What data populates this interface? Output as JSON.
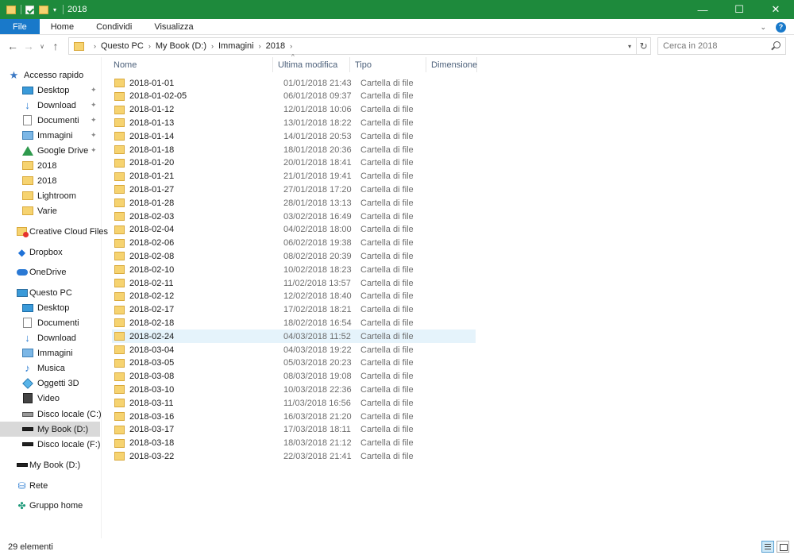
{
  "window": {
    "title": "2018",
    "controls": {
      "minimize": "—",
      "maximize": "☐",
      "close": "✕"
    }
  },
  "ribbon": {
    "tabs": [
      "File",
      "Home",
      "Condividi",
      "Visualizza"
    ]
  },
  "address": {
    "breadcrumbs": [
      "Questo PC",
      "My Book (D:)",
      "Immagini",
      "2018"
    ],
    "search_placeholder": "Cerca in 2018"
  },
  "sidebar": {
    "items": [
      {
        "label": "Accesso rapido",
        "icon": "star-icon",
        "level": 0,
        "pinned": false
      },
      {
        "label": "Desktop",
        "icon": "desktop-icon",
        "level": 1,
        "pinned": true
      },
      {
        "label": "Download",
        "icon": "download-icon",
        "level": 1,
        "pinned": true
      },
      {
        "label": "Documenti",
        "icon": "documents-icon",
        "level": 1,
        "pinned": true
      },
      {
        "label": "Immagini",
        "icon": "pictures-icon",
        "level": 1,
        "pinned": true
      },
      {
        "label": "Google Drive",
        "icon": "google-drive-icon",
        "level": 1,
        "pinned": true
      },
      {
        "label": "2018",
        "icon": "folder-icon",
        "level": 1,
        "pinned": false
      },
      {
        "label": "2018",
        "icon": "folder-icon",
        "level": 1,
        "pinned": false
      },
      {
        "label": "Lightroom",
        "icon": "folder-icon",
        "level": 1,
        "pinned": false
      },
      {
        "label": "Varie",
        "icon": "folder-icon",
        "level": 1,
        "pinned": false
      },
      {
        "label": "Creative Cloud Files",
        "icon": "creative-cloud-icon",
        "level": 0,
        "pinned": false
      },
      {
        "label": "Dropbox",
        "icon": "dropbox-icon",
        "level": 0,
        "pinned": false
      },
      {
        "label": "OneDrive",
        "icon": "onedrive-icon",
        "level": 0,
        "pinned": false
      },
      {
        "label": "Questo PC",
        "icon": "computer-icon",
        "level": 0,
        "pinned": false
      },
      {
        "label": "Desktop",
        "icon": "desktop-icon",
        "level": 1,
        "pinned": false
      },
      {
        "label": "Documenti",
        "icon": "documents-icon",
        "level": 1,
        "pinned": false
      },
      {
        "label": "Download",
        "icon": "download-icon",
        "level": 1,
        "pinned": false
      },
      {
        "label": "Immagini",
        "icon": "pictures-icon",
        "level": 1,
        "pinned": false
      },
      {
        "label": "Musica",
        "icon": "music-icon",
        "level": 1,
        "pinned": false
      },
      {
        "label": "Oggetti 3D",
        "icon": "objects-3d-icon",
        "level": 1,
        "pinned": false
      },
      {
        "label": "Video",
        "icon": "video-icon",
        "level": 1,
        "pinned": false
      },
      {
        "label": "Disco locale (C:)",
        "icon": "windows-drive-icon",
        "level": 1,
        "pinned": false
      },
      {
        "label": "My Book (D:)",
        "icon": "external-drive-icon",
        "level": 1,
        "pinned": false,
        "selected": true
      },
      {
        "label": "Disco locale (F:)",
        "icon": "drive-icon",
        "level": 1,
        "pinned": false
      },
      {
        "label": "My Book (D:)",
        "icon": "external-drive-icon",
        "level": 0,
        "pinned": false
      },
      {
        "label": "Rete",
        "icon": "network-icon",
        "level": 0,
        "pinned": false
      },
      {
        "label": "Gruppo home",
        "icon": "homegroup-icon",
        "level": 0,
        "pinned": false
      }
    ]
  },
  "files": {
    "columns": [
      "Nome",
      "Ultima modifica",
      "Tipo",
      "Dimensione"
    ],
    "rows": [
      {
        "name": "2018-01-01",
        "modified": "01/01/2018 21:43",
        "type": "Cartella di file"
      },
      {
        "name": "2018-01-02-05",
        "modified": "06/01/2018 09:37",
        "type": "Cartella di file"
      },
      {
        "name": "2018-01-12",
        "modified": "12/01/2018 10:06",
        "type": "Cartella di file"
      },
      {
        "name": "2018-01-13",
        "modified": "13/01/2018 18:22",
        "type": "Cartella di file"
      },
      {
        "name": "2018-01-14",
        "modified": "14/01/2018 20:53",
        "type": "Cartella di file"
      },
      {
        "name": "2018-01-18",
        "modified": "18/01/2018 20:36",
        "type": "Cartella di file"
      },
      {
        "name": "2018-01-20",
        "modified": "20/01/2018 18:41",
        "type": "Cartella di file"
      },
      {
        "name": "2018-01-21",
        "modified": "21/01/2018 19:41",
        "type": "Cartella di file"
      },
      {
        "name": "2018-01-27",
        "modified": "27/01/2018 17:20",
        "type": "Cartella di file"
      },
      {
        "name": "2018-01-28",
        "modified": "28/01/2018 13:13",
        "type": "Cartella di file"
      },
      {
        "name": "2018-02-03",
        "modified": "03/02/2018 16:49",
        "type": "Cartella di file"
      },
      {
        "name": "2018-02-04",
        "modified": "04/02/2018 18:00",
        "type": "Cartella di file"
      },
      {
        "name": "2018-02-06",
        "modified": "06/02/2018 19:38",
        "type": "Cartella di file"
      },
      {
        "name": "2018-02-08",
        "modified": "08/02/2018 20:39",
        "type": "Cartella di file"
      },
      {
        "name": "2018-02-10",
        "modified": "10/02/2018 18:23",
        "type": "Cartella di file"
      },
      {
        "name": "2018-02-11",
        "modified": "11/02/2018 13:57",
        "type": "Cartella di file"
      },
      {
        "name": "2018-02-12",
        "modified": "12/02/2018 18:40",
        "type": "Cartella di file"
      },
      {
        "name": "2018-02-17",
        "modified": "17/02/2018 18:21",
        "type": "Cartella di file"
      },
      {
        "name": "2018-02-18",
        "modified": "18/02/2018 16:54",
        "type": "Cartella di file"
      },
      {
        "name": "2018-02-24",
        "modified": "04/03/2018 11:52",
        "type": "Cartella di file",
        "highlighted": true
      },
      {
        "name": "2018-03-04",
        "modified": "04/03/2018 19:22",
        "type": "Cartella di file"
      },
      {
        "name": "2018-03-05",
        "modified": "05/03/2018 20:23",
        "type": "Cartella di file"
      },
      {
        "name": "2018-03-08",
        "modified": "08/03/2018 19:08",
        "type": "Cartella di file"
      },
      {
        "name": "2018-03-10",
        "modified": "10/03/2018 22:36",
        "type": "Cartella di file"
      },
      {
        "name": "2018-03-11",
        "modified": "11/03/2018 16:56",
        "type": "Cartella di file"
      },
      {
        "name": "2018-03-16",
        "modified": "16/03/2018 21:20",
        "type": "Cartella di file"
      },
      {
        "name": "2018-03-17",
        "modified": "17/03/2018 18:11",
        "type": "Cartella di file"
      },
      {
        "name": "2018-03-18",
        "modified": "18/03/2018 21:12",
        "type": "Cartella di file"
      },
      {
        "name": "2018-03-22",
        "modified": "22/03/2018 21:41",
        "type": "Cartella di file"
      }
    ]
  },
  "status": {
    "count_text": "29 elementi"
  },
  "colors": {
    "titlebar": "#1e8a3c",
    "file_tab": "#1979ca",
    "folder": "#f6d370",
    "hover_row": "#e5f3fb",
    "selected_nav": "#d9d9d9"
  }
}
